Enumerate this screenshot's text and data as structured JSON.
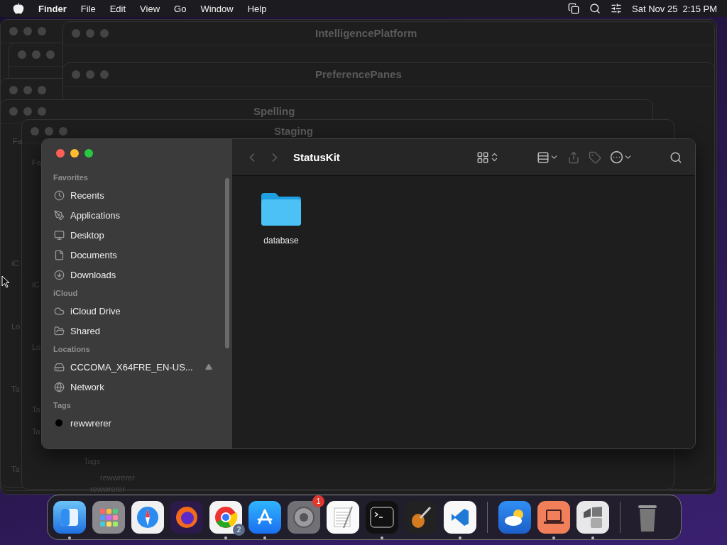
{
  "menu_bar": {
    "app": "Finder",
    "menus": [
      "File",
      "Edit",
      "View",
      "Go",
      "Window",
      "Help"
    ],
    "clock": "Sat Nov 25  2:15 PM"
  },
  "background_windows": [
    {
      "title": "IntelligencePlatform"
    },
    {
      "title": "PreferencePanes"
    },
    {
      "title": "Spelling"
    },
    {
      "title": "Staging"
    }
  ],
  "background_fragments": [
    "Fa",
    "Fa",
    "iC",
    "iC",
    "Lo",
    "Lo",
    "Ta",
    "Ta",
    "Ta",
    "Ta",
    "Tags",
    "rewwrerer",
    "rewwrerer"
  ],
  "window": {
    "title": "StatusKit",
    "back_disabled": true,
    "forward_disabled": true,
    "sidebar": [
      {
        "heading": "Favorites",
        "items": [
          {
            "label": "Recents",
            "selected": false
          },
          {
            "label": "Applications",
            "selected": false
          },
          {
            "label": "Desktop",
            "selected": false
          },
          {
            "label": "Documents",
            "selected": false
          },
          {
            "label": "Downloads",
            "selected": false
          }
        ]
      },
      {
        "heading": "iCloud",
        "items": [
          {
            "label": "iCloud Drive",
            "selected": false
          },
          {
            "label": "Shared",
            "selected": false
          }
        ]
      },
      {
        "heading": "Locations",
        "items": [
          {
            "label": "CCCOMA_X64FRE_EN-US...",
            "selected": false,
            "ejectable": true
          },
          {
            "label": "Network",
            "selected": false
          }
        ]
      },
      {
        "heading": "Tags",
        "items": [
          {
            "label": "rewwrerer",
            "color": "#000000",
            "selected": false
          }
        ]
      }
    ],
    "files": [
      {
        "name": "database",
        "kind": "folder",
        "selected": false
      }
    ]
  },
  "dock": [
    {
      "kind": "app",
      "running": true
    },
    {
      "kind": "app",
      "running": false
    },
    {
      "kind": "app",
      "running": false
    },
    {
      "kind": "app",
      "running": false
    },
    {
      "kind": "app",
      "running": true,
      "badge": "2"
    },
    {
      "kind": "app",
      "running": true
    },
    {
      "kind": "app",
      "running": false,
      "badge": "1"
    },
    {
      "kind": "app",
      "running": false
    },
    {
      "kind": "app",
      "running": true
    },
    {
      "kind": "app",
      "running": false
    },
    {
      "kind": "app",
      "running": true
    },
    {
      "kind": "separator"
    },
    {
      "kind": "app",
      "running": false
    },
    {
      "kind": "app",
      "running": true
    },
    {
      "kind": "app",
      "running": true
    },
    {
      "kind": "separator"
    },
    {
      "kind": "trash",
      "running": false
    }
  ]
}
